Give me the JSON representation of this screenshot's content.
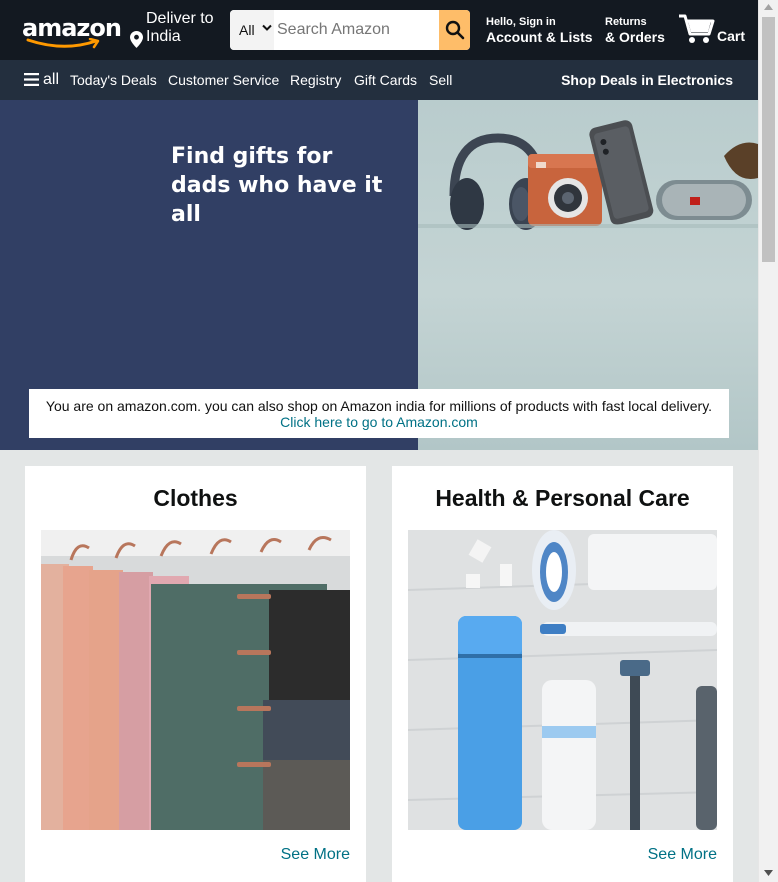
{
  "header": {
    "logo_text": "amazon",
    "deliver_line1": "Deliver to",
    "deliver_line2": "India",
    "search": {
      "category": "All",
      "placeholder": "Search Amazon"
    },
    "account_line1": "Hello, Sign in",
    "account_line2": "Account & Lists",
    "returns_line1": "Returns",
    "returns_line2": "& Orders",
    "cart_label": "Cart"
  },
  "subnav": {
    "all_label": "all",
    "items": [
      "Today's Deals",
      "Customer Service",
      "Registry",
      "Gift Cards",
      "Sell"
    ],
    "promo": "Shop Deals in Electronics"
  },
  "hero": {
    "title_line1": "Find gifts for",
    "title_line2": "dads who have it all",
    "notice_text": "You are on amazon.com. you can also shop on Amazon india for millions of products with fast local delivery.",
    "notice_link": "Click here to go to Amazon.com"
  },
  "cards": [
    {
      "title": "Clothes",
      "link": "See More"
    },
    {
      "title": "Health & Personal Care",
      "link": "See More"
    }
  ],
  "colors": {
    "nav_top": "#131921",
    "nav_sub": "#232f3e",
    "search_button": "#febd69",
    "hero_left": "#313f64",
    "link": "#007185",
    "page_bg": "#e3e6e6"
  }
}
